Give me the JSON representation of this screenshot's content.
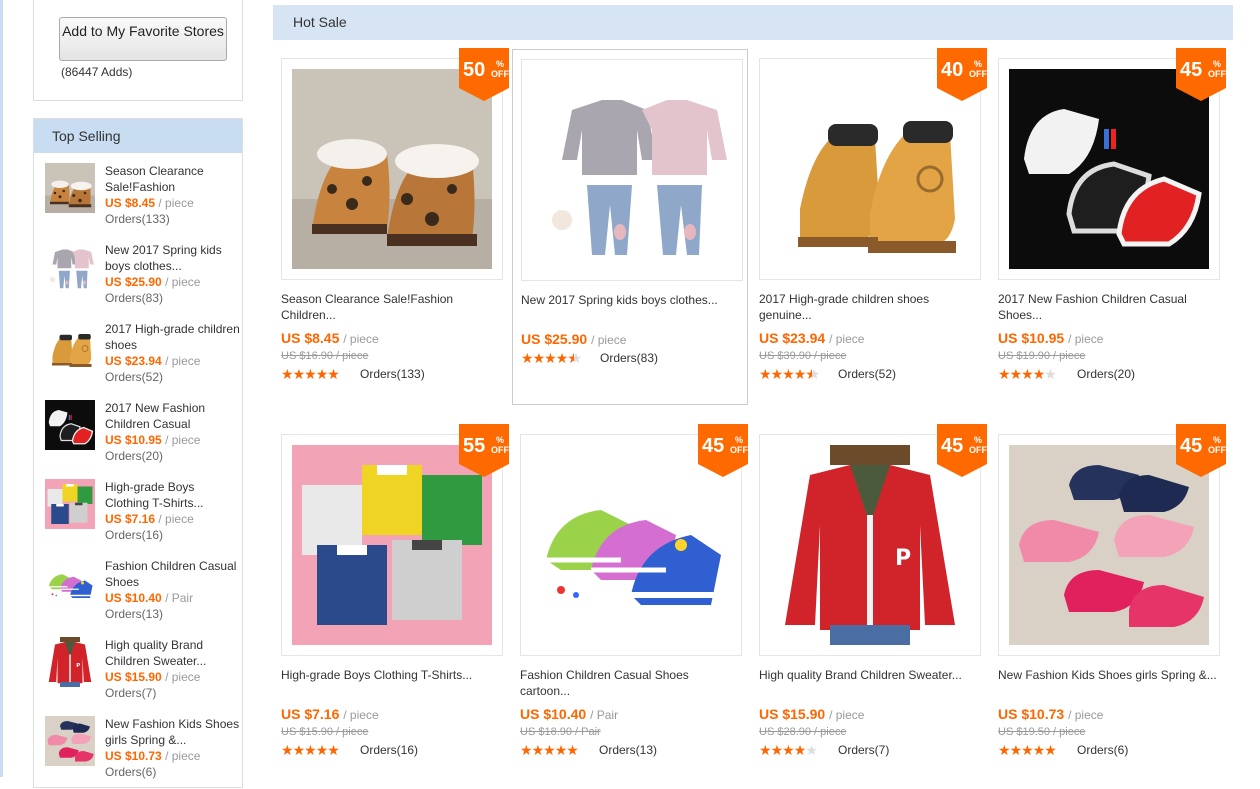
{
  "favorite": {
    "button_label": "Add to My Favorite Stores",
    "adds": "(86447 Adds)"
  },
  "top_selling": {
    "heading": "Top Selling",
    "items": [
      {
        "title": "Season Clearance Sale!Fashion",
        "price": "US $8.45",
        "unit": "/ piece",
        "orders": "Orders(133)"
      },
      {
        "title": "New 2017 Spring kids boys clothes...",
        "price": "US $25.90",
        "unit": "/ piece",
        "orders": "Orders(83)"
      },
      {
        "title": "2017 High-grade children shoes",
        "price": "US $23.94",
        "unit": "/ piece",
        "orders": "Orders(52)"
      },
      {
        "title": "2017 New Fashion Children Casual",
        "price": "US $10.95",
        "unit": "/ piece",
        "orders": "Orders(20)"
      },
      {
        "title": "High-grade Boys Clothing T-Shirts...",
        "price": "US $7.16",
        "unit": "/ piece",
        "orders": "Orders(16)"
      },
      {
        "title": "Fashion Children Casual Shoes",
        "price": "US $10.40",
        "unit": "/ Pair",
        "orders": "Orders(13)"
      },
      {
        "title": "High quality Brand Children Sweater...",
        "price": "US $15.90",
        "unit": "/ piece",
        "orders": "Orders(7)"
      },
      {
        "title": "New Fashion Kids Shoes girls Spring &...",
        "price": "US $10.73",
        "unit": "/ piece",
        "orders": "Orders(6)"
      }
    ]
  },
  "hot_sale": {
    "heading": "Hot Sale",
    "off_label": "OFF",
    "pct_label": "%",
    "products": [
      {
        "title": "Season Clearance Sale!Fashion Children...",
        "discount": "50",
        "price": "US $8.45",
        "unit": "/ piece",
        "old_price": "US $16.90 / piece",
        "rating": 5,
        "orders": "Orders(133)"
      },
      {
        "title": "New 2017 Spring kids boys clothes...",
        "discount": "",
        "price": "US $25.90",
        "unit": "/ piece",
        "old_price": "",
        "rating": 4.5,
        "orders": "Orders(83)"
      },
      {
        "title": "2017 High-grade children shoes genuine...",
        "discount": "40",
        "price": "US $23.94",
        "unit": "/ piece",
        "old_price": "US $39.90 / piece",
        "rating": 4.5,
        "orders": "Orders(52)"
      },
      {
        "title": "2017 New Fashion Children Casual Shoes...",
        "discount": "45",
        "price": "US $10.95",
        "unit": "/ piece",
        "old_price": "US $19.90 / piece",
        "rating": 4,
        "orders": "Orders(20)"
      },
      {
        "title": "High-grade Boys Clothing T-Shirts...",
        "discount": "55",
        "price": "US $7.16",
        "unit": "/ piece",
        "old_price": "US $15.90 / piece",
        "rating": 5,
        "orders": "Orders(16)"
      },
      {
        "title": "Fashion Children Casual Shoes cartoon...",
        "discount": "45",
        "price": "US $10.40",
        "unit": "/ Pair",
        "old_price": "US $18.90 / Pair",
        "rating": 5,
        "orders": "Orders(13)"
      },
      {
        "title": "High quality Brand Children Sweater...",
        "discount": "45",
        "price": "US $15.90",
        "unit": "/ piece",
        "old_price": "US $28.90 / piece",
        "rating": 4,
        "orders": "Orders(7)"
      },
      {
        "title": "New Fashion Kids Shoes girls Spring &...",
        "discount": "45",
        "price": "US $10.73",
        "unit": "/ piece",
        "old_price": "US $19.50 / piece",
        "rating": 5,
        "orders": "Orders(6)"
      }
    ]
  },
  "colors": {
    "accent": "#ff6600",
    "header_bg": "#c9ddf2",
    "star": "#ff6600"
  }
}
